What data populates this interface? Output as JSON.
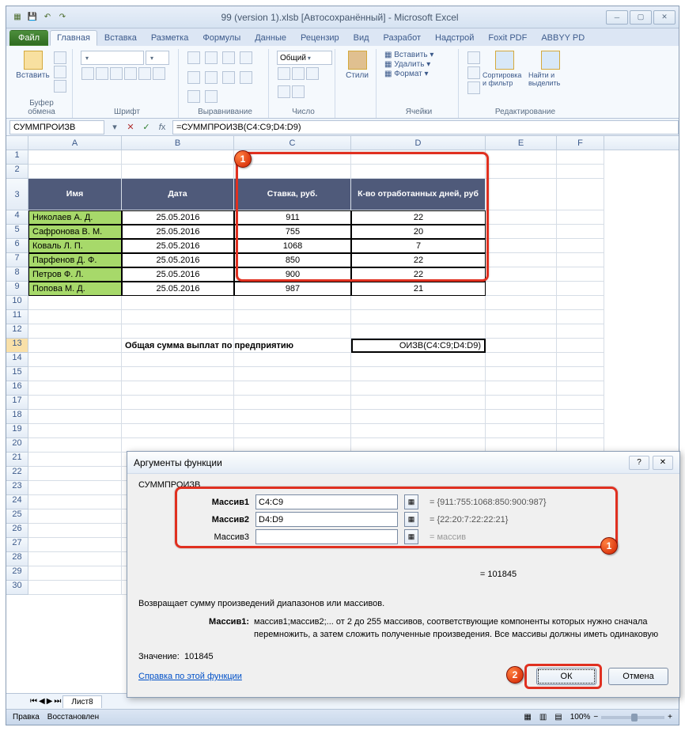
{
  "title": "99 (version 1).xlsb [Автосохранённый] - Microsoft Excel",
  "tabs": {
    "file": "Файл",
    "list": [
      "Главная",
      "Вставка",
      "Разметка",
      "Формулы",
      "Данные",
      "Рецензир",
      "Вид",
      "Разработ",
      "Надстрой",
      "Foxit PDF",
      "ABBYY PD"
    ],
    "active": 0
  },
  "ribbon": {
    "paste": "Вставить",
    "clipboard": "Буфер обмена",
    "font": "Шрифт",
    "font_name": "",
    "font_size": "",
    "alignment": "Выравнивание",
    "number": "Число",
    "number_format": "Общий",
    "styles": "Стили",
    "cells": "Ячейки",
    "insert": "Вставить",
    "delete": "Удалить",
    "format": "Формат",
    "editing": "Редактирование",
    "sort_filter": "Сортировка и фильтр",
    "find_select": "Найти и выделить"
  },
  "formula_bar": {
    "name": "СУММПРОИЗВ",
    "formula": "=СУММПРОИЗВ(C4:C9;D4:D9)"
  },
  "columns": [
    "A",
    "B",
    "C",
    "D",
    "E",
    "F"
  ],
  "col_widths": [
    "cA",
    "cB",
    "cC",
    "cD",
    "cE",
    "cF"
  ],
  "table": {
    "headers": [
      "Имя",
      "Дата",
      "Ставка, руб.",
      "К-во отработанных дней, руб"
    ],
    "rows": [
      {
        "name": "Николаев А. Д.",
        "date": "25.05.2016",
        "rate": "911",
        "days": "22"
      },
      {
        "name": "Сафронова В. М.",
        "date": "25.05.2016",
        "rate": "755",
        "days": "20"
      },
      {
        "name": "Коваль Л. П.",
        "date": "25.05.2016",
        "rate": "1068",
        "days": "7"
      },
      {
        "name": "Парфенов Д. Ф.",
        "date": "25.05.2016",
        "rate": "850",
        "days": "22"
      },
      {
        "name": "Петров Ф. Л.",
        "date": "25.05.2016",
        "rate": "900",
        "days": "22"
      },
      {
        "name": "Попова М. Д.",
        "date": "25.05.2016",
        "rate": "987",
        "days": "21"
      }
    ],
    "total_label": "Общая сумма выплат по предприятию",
    "total_cell": "ОИЗВ(C4:C9;D4:D9)"
  },
  "dialog": {
    "title": "Аргументы функции",
    "function": "СУММПРОИЗВ",
    "args": [
      {
        "label": "Массив1",
        "value": "C4:C9",
        "result": "= {911:755:1068:850:900:987}"
      },
      {
        "label": "Массив2",
        "value": "D4:D9",
        "result": "= {22:20:7:22:22:21}"
      },
      {
        "label": "Массив3",
        "value": "",
        "result": "= массив"
      }
    ],
    "result_line": "= 101845",
    "desc1": "Возвращает сумму произведений диапазонов или массивов.",
    "desc_label": "Массив1:",
    "desc2": "массив1;массив2;... от 2 до 255 массивов, соответствующие компоненты которых нужно сначала перемножить, а затем сложить полученные произведения. Все массивы должны иметь одинаковую",
    "value_label": "Значение:",
    "value": "101845",
    "help": "Справка по этой функции",
    "ok": "ОК",
    "cancel": "Отмена"
  },
  "sheet_tab": "Лист8",
  "status": {
    "mode": "Правка",
    "restore": "Восстановлен",
    "zoom": "100%"
  },
  "chart_data": null
}
